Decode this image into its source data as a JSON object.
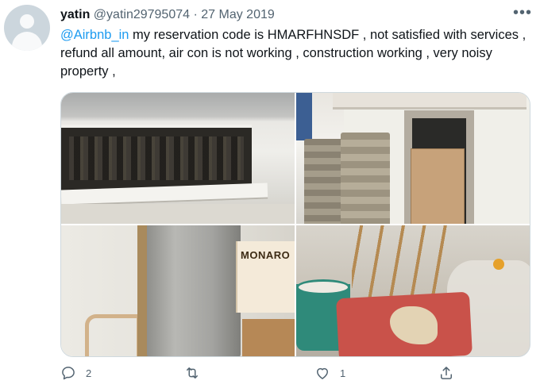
{
  "tweet": {
    "display_name": "yatin",
    "handle": "@yatin29795074",
    "separator": "·",
    "date": "27 May 2019",
    "mention": "@Airbnb_in",
    "text": " my reservation code is HMARFHNSDF , not satisfied with services , refund all amount, air con is not working , construction working , very noisy property ,"
  },
  "media": {
    "box_label": "MONARO"
  },
  "actions": {
    "replies": "2",
    "retweets": "",
    "likes": "1"
  },
  "icons": {
    "more": "more-icon",
    "reply": "reply-icon",
    "retweet": "retweet-icon",
    "like": "like-icon",
    "share": "share-icon"
  },
  "colors": {
    "link": "#1d9bf0",
    "secondary_text": "#536471",
    "border": "#cfd9de"
  }
}
